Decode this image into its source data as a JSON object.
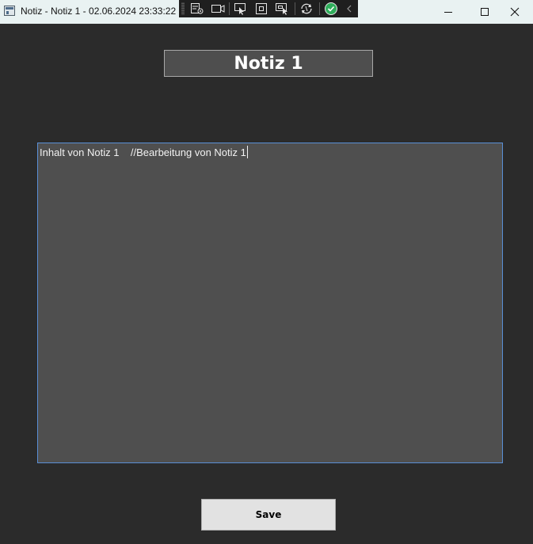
{
  "window": {
    "title": "Notiz - Notiz 1 - 02.06.2024 23:33:22",
    "app_icon": "window-app-icon",
    "controls": {
      "minimize_icon": "minimize-icon",
      "maximize_icon": "maximize-icon",
      "close_icon": "close-icon"
    }
  },
  "debug_toolbar": {
    "items": [
      "live-visual-tree-icon",
      "video-camera-icon",
      "select-element-icon",
      "display-layout-adorners-icon",
      "track-focused-element-icon",
      "hot-reload-icon",
      "binding-failures-ok-icon",
      "collapse-toolbar-icon"
    ],
    "status_color": "#2fae5b"
  },
  "note": {
    "title": "Notiz 1",
    "content": "Inhalt von Notiz 1    //Bearbeitung von Notiz 1"
  },
  "actions": {
    "save_label": "Save"
  },
  "colors": {
    "background": "#2b2b2b",
    "titlebar": "#e9f2f2",
    "textbox_border_focused": "#5a8fd6"
  }
}
